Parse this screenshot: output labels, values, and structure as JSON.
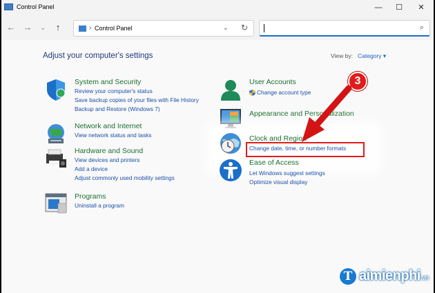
{
  "window": {
    "title": "Control Panel",
    "minimize_glyph": "—",
    "maximize_glyph": "☐",
    "close_glyph": "✕"
  },
  "nav": {
    "back_glyph": "←",
    "forward_glyph": "→",
    "recent_glyph": "⌄",
    "up_glyph": "↑",
    "breadcrumb_separator": "›",
    "breadcrumb": "Control Panel",
    "dropdown_glyph": "⌄",
    "refresh_glyph": "↻",
    "search_placeholder": "",
    "search_glyph": "⌕"
  },
  "main": {
    "heading": "Adjust your computer's settings",
    "view_by_label": "View by:",
    "view_by_value": "Category ▾"
  },
  "categories": {
    "system": {
      "title": "System and Security",
      "links": [
        "Review your computer's status",
        "Save backup copies of your files with File History",
        "Backup and Restore (Windows 7)"
      ]
    },
    "network": {
      "title": "Network and Internet",
      "links": [
        "View network status and tasks"
      ]
    },
    "hardware": {
      "title": "Hardware and Sound",
      "links": [
        "View devices and printers",
        "Add a device",
        "Adjust commonly used mobility settings"
      ]
    },
    "programs": {
      "title": "Programs",
      "links": [
        "Uninstall a program"
      ]
    },
    "users": {
      "title": "User Accounts",
      "links": [
        "Change account type"
      ]
    },
    "appearance": {
      "title": "Appearance and Personalization",
      "links": []
    },
    "clock": {
      "title": "Clock and Region",
      "links": [
        "Change date, time, or number formats"
      ]
    },
    "ease": {
      "title": "Ease of Access",
      "links": [
        "Let Windows suggest settings",
        "Optimize visual display"
      ]
    }
  },
  "annotation": {
    "step_number": "3",
    "color": "#e21b1b"
  },
  "watermark": {
    "logo_letter": "T",
    "text": "aimienphi",
    "suffix": ".vn"
  },
  "colors": {
    "link": "#1a4ea8",
    "category_title": "#1b6f2f",
    "heading": "#1e3a78"
  }
}
